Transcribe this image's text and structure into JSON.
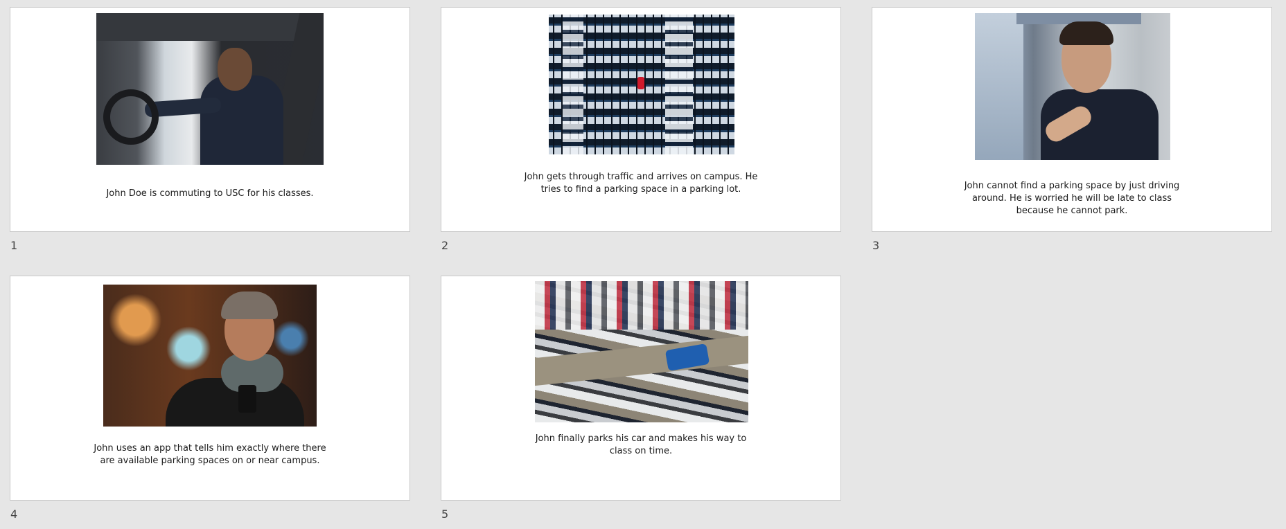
{
  "slides": [
    {
      "number": "1",
      "caption": "John Doe is commuting to USC for his classes.",
      "image": "man-driving-car-photo"
    },
    {
      "number": "2",
      "caption": "John gets through traffic and arrives on campus. He tries to find a parking space in a parking lot.",
      "image": "aerial-parking-lot-photo"
    },
    {
      "number": "3",
      "caption": "John cannot find a parking space by just driving around. He is worried he will be late to class because he cannot park.",
      "image": "frustrated-driver-photo"
    },
    {
      "number": "4",
      "caption": "John uses an app that tells him exactly where there are available parking spaces on or near campus.",
      "image": "man-smiling-at-phone-photo"
    },
    {
      "number": "5",
      "caption": "John finally parks his car and makes his way to class on time.",
      "image": "crowded-parking-lot-photo"
    }
  ],
  "colors": {
    "background": "#e6e6e6",
    "slide": "#ffffff",
    "border": "#c8c8c8"
  }
}
